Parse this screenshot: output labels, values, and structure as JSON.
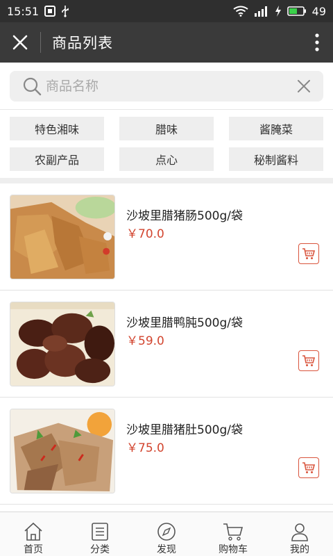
{
  "status_bar": {
    "time": "15:51",
    "battery": "49",
    "icons": [
      "notification-icon",
      "usb-icon",
      "wifi-icon",
      "signal-icon",
      "charging-icon",
      "battery-icon"
    ]
  },
  "header": {
    "title": "商品列表",
    "close_icon": "close-icon",
    "more_icon": "more-vertical-icon"
  },
  "search": {
    "placeholder": "商品名称",
    "value": "",
    "search_icon": "search-icon",
    "clear_icon": "clear-icon"
  },
  "categories": [
    {
      "label": "特色湘味"
    },
    {
      "label": "腊味"
    },
    {
      "label": "酱腌菜"
    },
    {
      "label": "农副产品"
    },
    {
      "label": "点心"
    },
    {
      "label": "秘制酱料"
    }
  ],
  "products": [
    {
      "name": "沙坡里腊猪肠500g/袋",
      "price": "￥70.0",
      "image": "cured-pork-intestine-photo"
    },
    {
      "name": "沙坡里腊鸭肫500g/袋",
      "price": "￥59.0",
      "image": "cured-duck-gizzard-photo"
    },
    {
      "name": "沙坡里腊猪肚500g/袋",
      "price": "￥75.0",
      "image": "cured-pork-tripe-photo"
    }
  ],
  "bottom_nav": [
    {
      "label": "首页",
      "icon": "home-icon"
    },
    {
      "label": "分类",
      "icon": "category-icon"
    },
    {
      "label": "发现",
      "icon": "compass-icon"
    },
    {
      "label": "购物车",
      "icon": "cart-icon"
    },
    {
      "label": "我的",
      "icon": "user-icon"
    }
  ],
  "colors": {
    "status_bar": "#2f2f2f",
    "title_bar": "#3a3a3a",
    "price": "#d2452f",
    "cart_accent": "#d9543c"
  }
}
